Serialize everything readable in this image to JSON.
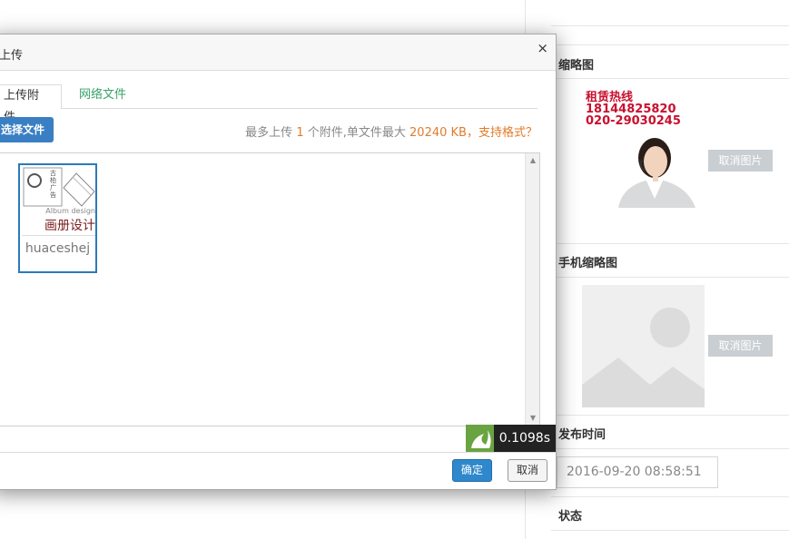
{
  "panel": {
    "thumbnail_title": "缩略图",
    "mobile_thumbnail_title": "手机缩略图",
    "publish_time_title": "发布时间",
    "status_title": "状态",
    "cancel_image_label": "取消图片",
    "publish_time_value": "2016-09-20 08:58:51",
    "thumb_ad": {
      "hotline": "租赁热线",
      "phone1": "18144825820",
      "phone2": "020-29030245"
    }
  },
  "dialog": {
    "title": "上传",
    "close": "×",
    "tabs": [
      {
        "label": "上传附件"
      },
      {
        "label": "网络文件"
      }
    ],
    "choose_file_label": "选择文件",
    "info": {
      "prefix": "最多上传",
      "count": "1",
      "middle": "个附件,单文件最大",
      "size": "20240 KB",
      "separator": "，",
      "formats_link": "支持格式？"
    },
    "file": {
      "name": "huaceshej",
      "preview_caption": "Album design",
      "preview_title": "画册设计",
      "preview_brand": "古柏广告"
    },
    "timing": "0.1098s",
    "ok_label": "确定",
    "cancel_label": "取消"
  },
  "colors": {
    "accent_blue": "#2f88cc",
    "link_green": "#3aa06b",
    "highlight_orange": "#e17b2a"
  }
}
